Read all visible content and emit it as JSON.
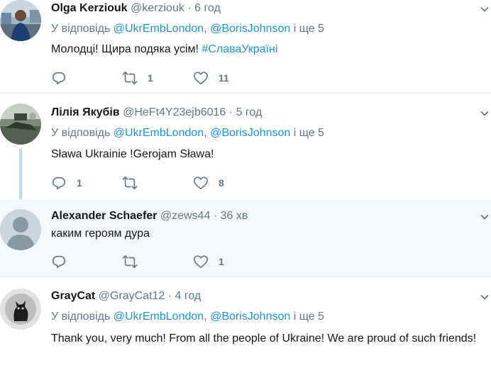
{
  "tweets": [
    {
      "name": "Olga Kerziouk",
      "handle": "@kerziouk",
      "dot": "·",
      "time": "6 год",
      "reply_prefix": "У відповідь",
      "mention1": "@UkrEmbLondon",
      "comma": ",",
      "mention2": "@BorisJohnson",
      "reply_suffix": "і ще 5",
      "text": "Молодці! Щира подяка усім! ",
      "hashtag": "#СлаваУкраїні",
      "replies": "",
      "retweets": "1",
      "likes": "11"
    },
    {
      "name": "Лілія Якубів",
      "handle": "@HeFt4Y23ejb6016",
      "dot": "·",
      "time": "5 год",
      "reply_prefix": "У відповідь",
      "mention1": "@UkrEmbLondon",
      "comma": ",",
      "mention2": "@BorisJohnson",
      "reply_suffix": "і ще 5",
      "text": "Sława Ukrainie !Gerojam Sława!",
      "replies": "1",
      "retweets": "",
      "likes": "8"
    },
    {
      "name": "Alexander Schaefer",
      "handle": "@zews44",
      "dot": "·",
      "time": "36 хв",
      "text": "каким героям дура",
      "replies": "",
      "retweets": "",
      "likes": "1"
    },
    {
      "name": "GrayCat",
      "handle": "@GrayCat12",
      "dot": "·",
      "time": "4 год",
      "reply_prefix": "У відповідь",
      "mention1": "@UkrEmbLondon",
      "comma": ",",
      "mention2": "@BorisJohnson",
      "reply_suffix": "і ще 5",
      "text": "Thank you, very much! From all the people of Ukraine! We are proud of such friends!"
    }
  ],
  "icons": {
    "reply": "reply-icon",
    "retweet": "retweet-icon",
    "like": "heart-icon",
    "more": "chevron-down-icon"
  },
  "colors": {
    "link": "#1b95e0",
    "muted": "#657786",
    "highlight_bg": "#f5f8fa",
    "thread_line": "#b8dfef"
  }
}
